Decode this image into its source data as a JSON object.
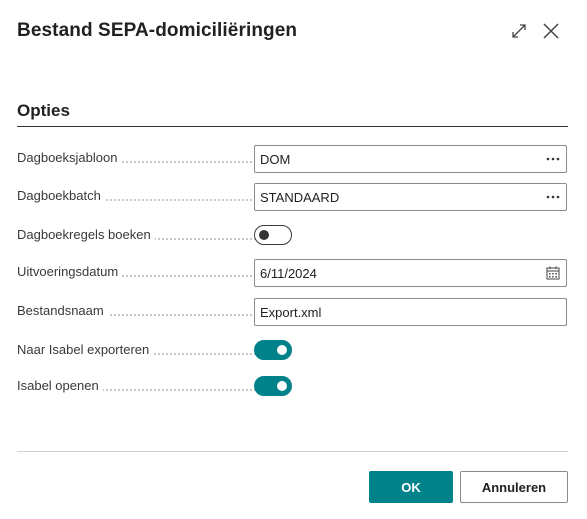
{
  "dialog": {
    "title": "Bestand SEPA-domiciliëringen"
  },
  "section": {
    "title": "Opties"
  },
  "fields": {
    "dagboeksjabloon": {
      "label": "Dagboeksjabloon",
      "value": "DOM"
    },
    "dagboekbatch": {
      "label": "Dagboekbatch",
      "value": "STANDAARD"
    },
    "dagboekregels_boeken": {
      "label": "Dagboekregels boeken",
      "state": "off"
    },
    "uitvoeringsdatum": {
      "label": "Uitvoeringsdatum",
      "value": "6/11/2024"
    },
    "bestandsnaam": {
      "label": "Bestandsnaam",
      "value": "Export.xml"
    },
    "naar_isabel_exporteren": {
      "label": "Naar Isabel exporteren",
      "state": "on"
    },
    "isabel_openen": {
      "label": "Isabel openen",
      "state": "on"
    }
  },
  "buttons": {
    "ok": "OK",
    "cancel": "Annuleren"
  },
  "icons": {
    "expand": "expand-icon",
    "close": "close-icon",
    "lookup": "ellipsis-icon",
    "calendar": "calendar-icon"
  },
  "colors": {
    "accent": "#00828a",
    "text": "#212121",
    "label": "#393939"
  }
}
